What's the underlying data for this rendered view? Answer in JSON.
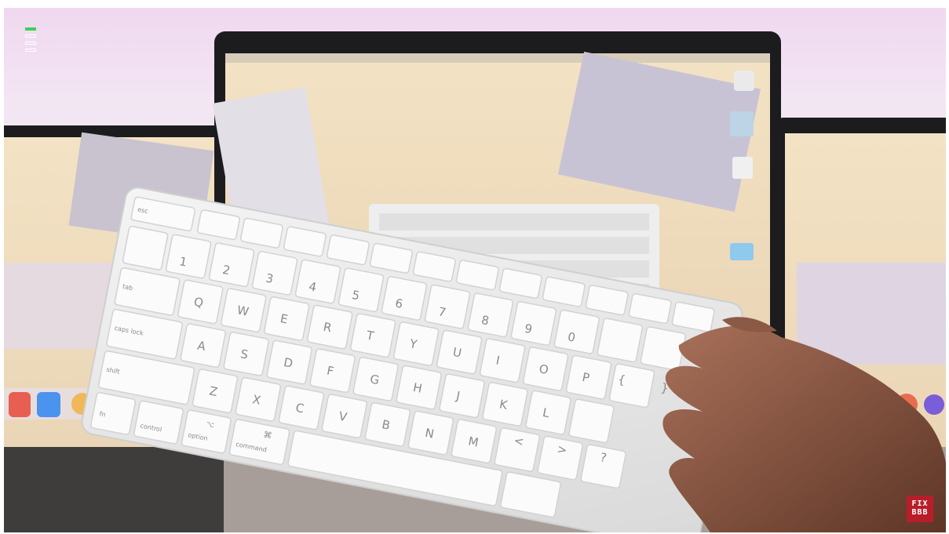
{
  "scene": {
    "keyboard_keys": {
      "esc": "esc",
      "tab": "tab",
      "caps": "caps lock",
      "shift": "shift",
      "fn": "fn",
      "control": "control",
      "option": "option",
      "command": "command",
      "command_symbol": "⌘",
      "option_symbol": "⌥"
    },
    "number_row": [
      "1",
      "2",
      "3",
      "4",
      "5",
      "6",
      "7",
      "8",
      "9",
      "0"
    ],
    "number_row_shift": [
      "!",
      "@",
      "#",
      "$",
      "%",
      "^",
      "&",
      "*",
      "(",
      ")"
    ],
    "row_q": [
      "Q",
      "W",
      "E",
      "R",
      "T",
      "Y",
      "U",
      "I",
      "O",
      "P"
    ],
    "row_a": [
      "A",
      "S",
      "D",
      "F",
      "G",
      "H",
      "J",
      "K",
      "L"
    ],
    "row_z": [
      "Z",
      "X",
      "C",
      "V",
      "B",
      "N",
      "M"
    ],
    "punct": [
      "{",
      "[",
      "}",
      "]",
      "<",
      ",",
      ">",
      ".",
      "?",
      "/",
      "\"",
      "'",
      "~",
      "`",
      "_",
      "-"
    ]
  },
  "progress": {
    "segments_total": 4,
    "segments_active": 1
  },
  "channel_logo": {
    "line1": "FIX",
    "line2": "BBB"
  },
  "colors": {
    "accent": "#39d353",
    "logo": "#b81e2a"
  }
}
